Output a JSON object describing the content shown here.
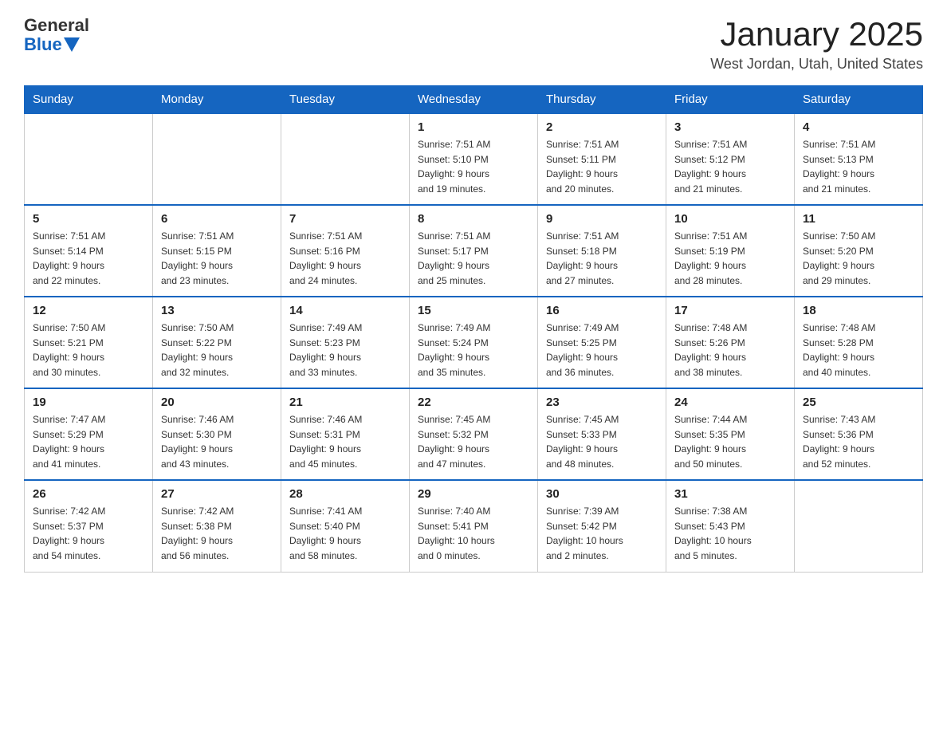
{
  "header": {
    "logo": {
      "general": "General",
      "blue": "Blue"
    },
    "title": "January 2025",
    "location": "West Jordan, Utah, United States"
  },
  "weekdays": [
    "Sunday",
    "Monday",
    "Tuesday",
    "Wednesday",
    "Thursday",
    "Friday",
    "Saturday"
  ],
  "weeks": [
    [
      null,
      null,
      null,
      {
        "day": 1,
        "sunrise": "7:51 AM",
        "sunset": "5:10 PM",
        "daylight": "9 hours and 19 minutes."
      },
      {
        "day": 2,
        "sunrise": "7:51 AM",
        "sunset": "5:11 PM",
        "daylight": "9 hours and 20 minutes."
      },
      {
        "day": 3,
        "sunrise": "7:51 AM",
        "sunset": "5:12 PM",
        "daylight": "9 hours and 21 minutes."
      },
      {
        "day": 4,
        "sunrise": "7:51 AM",
        "sunset": "5:13 PM",
        "daylight": "9 hours and 21 minutes."
      }
    ],
    [
      {
        "day": 5,
        "sunrise": "7:51 AM",
        "sunset": "5:14 PM",
        "daylight": "9 hours and 22 minutes."
      },
      {
        "day": 6,
        "sunrise": "7:51 AM",
        "sunset": "5:15 PM",
        "daylight": "9 hours and 23 minutes."
      },
      {
        "day": 7,
        "sunrise": "7:51 AM",
        "sunset": "5:16 PM",
        "daylight": "9 hours and 24 minutes."
      },
      {
        "day": 8,
        "sunrise": "7:51 AM",
        "sunset": "5:17 PM",
        "daylight": "9 hours and 25 minutes."
      },
      {
        "day": 9,
        "sunrise": "7:51 AM",
        "sunset": "5:18 PM",
        "daylight": "9 hours and 27 minutes."
      },
      {
        "day": 10,
        "sunrise": "7:51 AM",
        "sunset": "5:19 PM",
        "daylight": "9 hours and 28 minutes."
      },
      {
        "day": 11,
        "sunrise": "7:50 AM",
        "sunset": "5:20 PM",
        "daylight": "9 hours and 29 minutes."
      }
    ],
    [
      {
        "day": 12,
        "sunrise": "7:50 AM",
        "sunset": "5:21 PM",
        "daylight": "9 hours and 30 minutes."
      },
      {
        "day": 13,
        "sunrise": "7:50 AM",
        "sunset": "5:22 PM",
        "daylight": "9 hours and 32 minutes."
      },
      {
        "day": 14,
        "sunrise": "7:49 AM",
        "sunset": "5:23 PM",
        "daylight": "9 hours and 33 minutes."
      },
      {
        "day": 15,
        "sunrise": "7:49 AM",
        "sunset": "5:24 PM",
        "daylight": "9 hours and 35 minutes."
      },
      {
        "day": 16,
        "sunrise": "7:49 AM",
        "sunset": "5:25 PM",
        "daylight": "9 hours and 36 minutes."
      },
      {
        "day": 17,
        "sunrise": "7:48 AM",
        "sunset": "5:26 PM",
        "daylight": "9 hours and 38 minutes."
      },
      {
        "day": 18,
        "sunrise": "7:48 AM",
        "sunset": "5:28 PM",
        "daylight": "9 hours and 40 minutes."
      }
    ],
    [
      {
        "day": 19,
        "sunrise": "7:47 AM",
        "sunset": "5:29 PM",
        "daylight": "9 hours and 41 minutes."
      },
      {
        "day": 20,
        "sunrise": "7:46 AM",
        "sunset": "5:30 PM",
        "daylight": "9 hours and 43 minutes."
      },
      {
        "day": 21,
        "sunrise": "7:46 AM",
        "sunset": "5:31 PM",
        "daylight": "9 hours and 45 minutes."
      },
      {
        "day": 22,
        "sunrise": "7:45 AM",
        "sunset": "5:32 PM",
        "daylight": "9 hours and 47 minutes."
      },
      {
        "day": 23,
        "sunrise": "7:45 AM",
        "sunset": "5:33 PM",
        "daylight": "9 hours and 48 minutes."
      },
      {
        "day": 24,
        "sunrise": "7:44 AM",
        "sunset": "5:35 PM",
        "daylight": "9 hours and 50 minutes."
      },
      {
        "day": 25,
        "sunrise": "7:43 AM",
        "sunset": "5:36 PM",
        "daylight": "9 hours and 52 minutes."
      }
    ],
    [
      {
        "day": 26,
        "sunrise": "7:42 AM",
        "sunset": "5:37 PM",
        "daylight": "9 hours and 54 minutes."
      },
      {
        "day": 27,
        "sunrise": "7:42 AM",
        "sunset": "5:38 PM",
        "daylight": "9 hours and 56 minutes."
      },
      {
        "day": 28,
        "sunrise": "7:41 AM",
        "sunset": "5:40 PM",
        "daylight": "9 hours and 58 minutes."
      },
      {
        "day": 29,
        "sunrise": "7:40 AM",
        "sunset": "5:41 PM",
        "daylight": "10 hours and 0 minutes."
      },
      {
        "day": 30,
        "sunrise": "7:39 AM",
        "sunset": "5:42 PM",
        "daylight": "10 hours and 2 minutes."
      },
      {
        "day": 31,
        "sunrise": "7:38 AM",
        "sunset": "5:43 PM",
        "daylight": "10 hours and 5 minutes."
      },
      null
    ]
  ]
}
